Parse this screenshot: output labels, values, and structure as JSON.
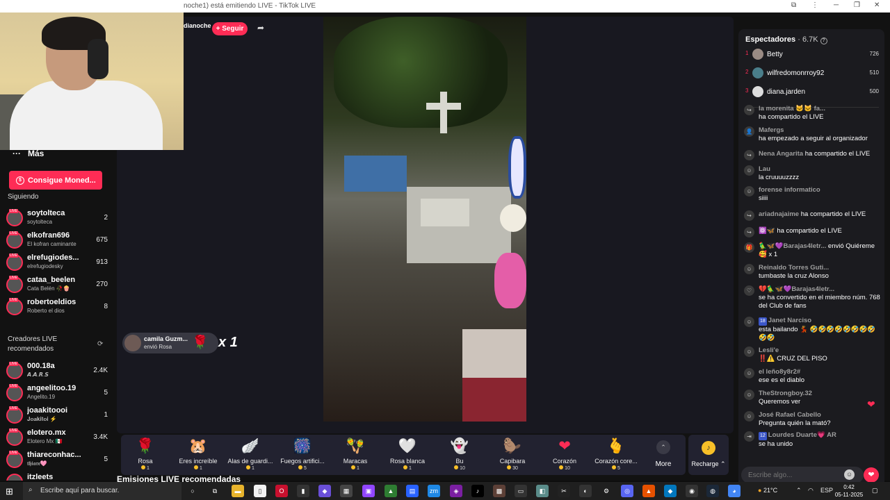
{
  "window": {
    "title": "noche1) está emitiendo LIVE - TikTok LIVE",
    "controls": [
      "⧉",
      "⋮",
      "─",
      "❐",
      "✕"
    ]
  },
  "host": {
    "name": "dianoche",
    "follow_label": "+ Seguir"
  },
  "sidebar": {
    "more_label": "Más",
    "coins_label": "Consigue Moned...",
    "following_heading": "Siguiendo",
    "following": [
      {
        "name": "soytolteca",
        "sub": "soytolteca",
        "count": "2"
      },
      {
        "name": "elkofran696",
        "sub": "El kofran caminante",
        "count": "675"
      },
      {
        "name": "elrefugiodes...",
        "sub": "elrefugiodesky",
        "count": "913"
      },
      {
        "name": "cataa_beelen",
        "sub": "Cata Belén 🥀🍿",
        "count": "270"
      },
      {
        "name": "robertoeldios",
        "sub": "Roberto el dios",
        "count": "8"
      }
    ],
    "recommended_heading": "Creadores LIVE recomendados",
    "recommended": [
      {
        "name": "000.18a",
        "sub": "𝘼.𝘼.𝙍.𝙎",
        "count": "2.4K"
      },
      {
        "name": "angeelitoo.19",
        "sub": "Angelito.19",
        "count": "5"
      },
      {
        "name": "joaakitoooi",
        "sub": "𝐉𝐨𝐚𝐤𝐢𝐭𝐨𝐢 ⚡",
        "count": "1"
      },
      {
        "name": "elotero.mx",
        "sub": "Elotero Mx 🇲🇽",
        "count": "3.4K"
      },
      {
        "name": "thiareconhac...",
        "sub": "𝖙𝖍𝖎𝖆𝖗𝖊🩷",
        "count": "5"
      },
      {
        "name": "itzleets",
        "sub": "",
        "count": ""
      }
    ]
  },
  "main": {
    "bottom_heading": "Emisiones LIVE recomendadas",
    "gift_notice": {
      "user": "camila Guzm...",
      "action": "envió Rosa",
      "multiplier": "x 1"
    }
  },
  "gifts": [
    {
      "name": "Rosa",
      "price": "1",
      "icon": "🌹"
    },
    {
      "name": "Eres increíble",
      "price": "1",
      "icon": "🐹"
    },
    {
      "name": "Alas de guardi...",
      "price": "1",
      "icon": "🪽"
    },
    {
      "name": "Fuegos artifici...",
      "price": "5",
      "icon": "🎆"
    },
    {
      "name": "Maracas",
      "price": "1",
      "icon": "🪇"
    },
    {
      "name": "Rosa blanca",
      "price": "1",
      "icon": "🤍"
    },
    {
      "name": "Bu",
      "price": "10",
      "icon": "👻"
    },
    {
      "name": "Capibara",
      "price": "30",
      "icon": "🦫"
    },
    {
      "name": "Corazón",
      "price": "10",
      "icon": "❤"
    },
    {
      "name": "Corazón core...",
      "price": "5",
      "icon": "🫰"
    }
  ],
  "gift_more_label": "More",
  "recharge_label": "Recharge",
  "chat": {
    "viewers_label": "Espectadores",
    "viewers_count": "· 6.7K",
    "ranking": [
      {
        "rank": "1",
        "name": "Betty",
        "score": "726"
      },
      {
        "rank": "2",
        "name": "wilfredomonrroy92",
        "score": "510"
      },
      {
        "rank": "3",
        "name": "diana.jarden",
        "score": "500"
      }
    ],
    "messages": [
      {
        "icon": "↪",
        "user": "la morenita 🐱🐱 fa...",
        "text": "ha compartido el LIVE"
      },
      {
        "icon": "👤",
        "user": "Mafergs",
        "text": "ha empezado a seguir al organizador"
      },
      {
        "icon": "↪",
        "user": "Nena Angarita",
        "text": "ha compartido el LIVE"
      },
      {
        "icon": "☺",
        "user": "Lau",
        "text": "la cruuuuzzzz"
      },
      {
        "icon": "☺",
        "user": "forense informatico",
        "text": "siiii"
      },
      {
        "icon": "↪",
        "user": "ariadnajaime",
        "text": "ha compartido el LIVE"
      },
      {
        "icon": "↪",
        "user": "⚛️🦋",
        "text": "ha compartido el LIVE"
      },
      {
        "icon": "🎁",
        "user": "🦜🦋💜Barajas4letr...",
        "text": "envió Quiéreme 🥰 x 1"
      },
      {
        "icon": "☺",
        "user": "Reinaldo Torres Guti...",
        "text": "tumbaste la cruz Alonso"
      },
      {
        "icon": "♡",
        "user": "💔🦜🦋💜Barajas4letr...",
        "text": "se ha convertido en el miembro núm. 768 del Club de fans"
      },
      {
        "icon": "☺",
        "user": "Janet Narciso",
        "text": "esta bailando 💃 🤣🤣🤣🤣🤣🤣🤣🤣🤣🤣",
        "badge": "18"
      },
      {
        "icon": "☺",
        "user": "Lesli'e",
        "text": "‼️⚠️ CRUZ DEL PISO"
      },
      {
        "icon": "☺",
        "user": "el leño8y8r2#",
        "text": "ese es el diablo"
      },
      {
        "icon": "☺",
        "user": "TheStrongboy.32",
        "text": "Queremos ver"
      },
      {
        "icon": "☺",
        "user": "José Rafael Cabello",
        "text": "Pregunta quién la mató?"
      },
      {
        "icon": "⇥",
        "user": "Lourdes Duarte💗 AR",
        "text": "se ha unido",
        "badge": "12"
      }
    ],
    "input_placeholder": "Escribe algo..."
  },
  "taskbar": {
    "search_placeholder": "Escribe aquí para buscar.",
    "weather": "21°C",
    "lang": "ESP",
    "time": "0:42",
    "date": "05-11-2025"
  }
}
